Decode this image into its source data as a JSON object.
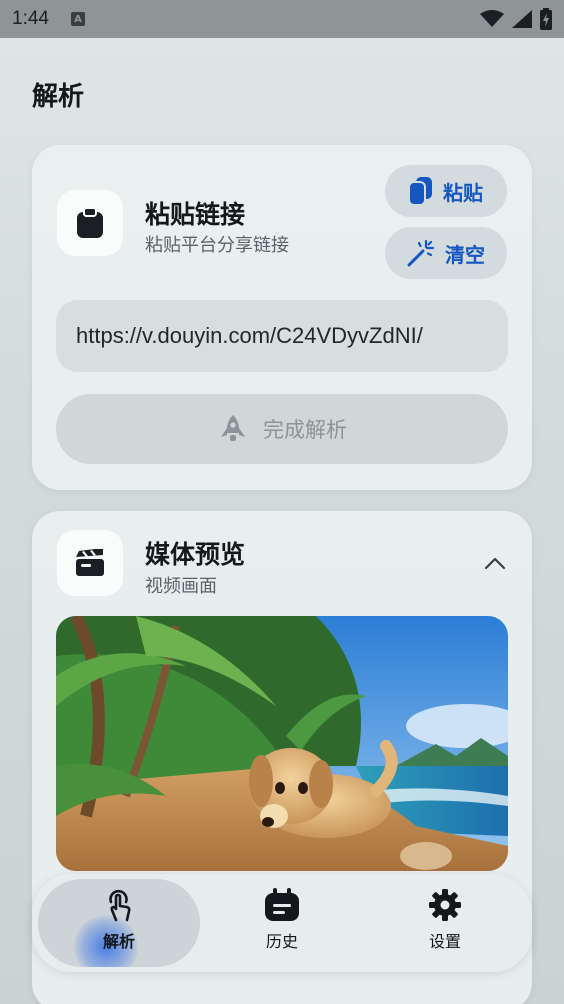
{
  "status_bar": {
    "time": "1:44",
    "indicator": "A"
  },
  "page": {
    "title": "解析"
  },
  "link_card": {
    "icon": "clipboard-icon",
    "title": "粘贴链接",
    "subtitle": "粘贴平台分享链接",
    "paste_label": "粘贴",
    "clear_label": "清空",
    "url_value": "https://v.douyin.com/C24VDyvZdNI/",
    "parse_label": "完成解析"
  },
  "media_card": {
    "icon": "clapperboard-icon",
    "title": "媒体预览",
    "subtitle": "视频画面",
    "preview_alt": "puppy on a tropical beach"
  },
  "nav": {
    "items": [
      {
        "label": "解析",
        "icon": "touch-icon",
        "active": true
      },
      {
        "label": "历史",
        "icon": "calendar-icon",
        "active": false
      },
      {
        "label": "设置",
        "icon": "gear-icon",
        "active": false
      }
    ]
  },
  "colors": {
    "accent": "#1557c0",
    "status_bar": "#8f9596"
  }
}
